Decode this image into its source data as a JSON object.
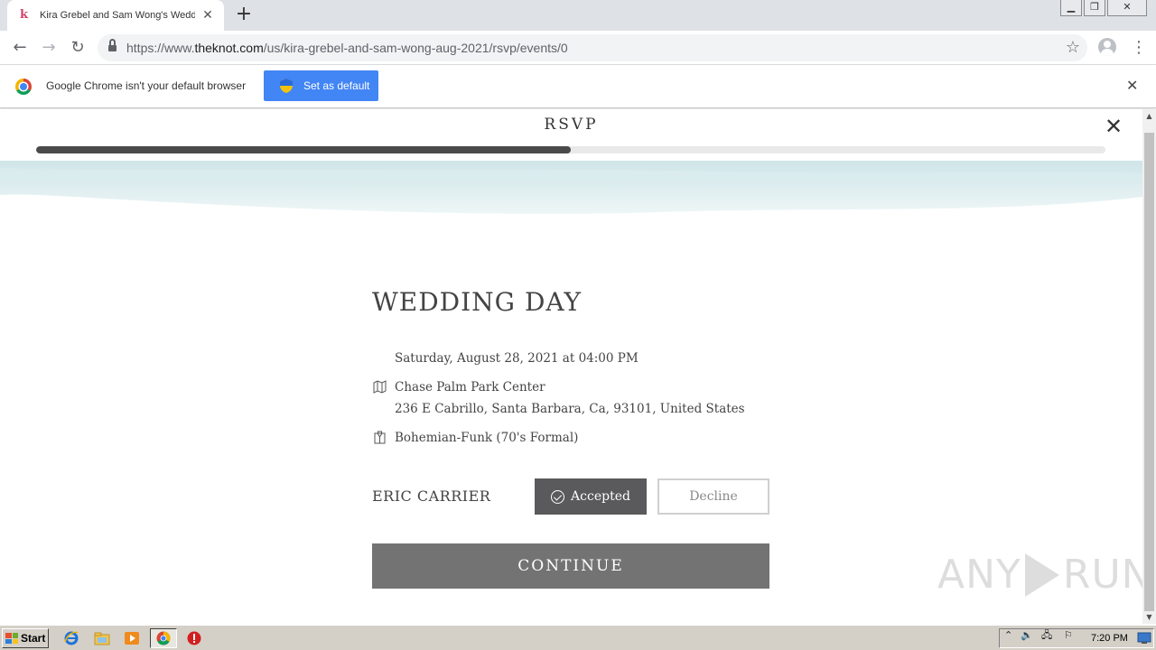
{
  "browser": {
    "tab_title": "Kira Grebel and Sam Wong's Wedding",
    "tab_favicon": "k",
    "url_scheme": "https://www.",
    "url_host": "theknot.com",
    "url_path": "/us/kira-grebel-and-sam-wong-aug-2021/rsvp/events/0",
    "infobar_message": "Google Chrome isn't your default browser",
    "set_default_label": "Set as default",
    "accent_color": "#4285f4"
  },
  "rsvp": {
    "title": "RSVP",
    "progress": 0.5,
    "event": {
      "name": "WEDDING DAY",
      "datetime": "Saturday, August 28, 2021 at 04:00 PM",
      "venue": "Chase Palm Park Center",
      "address": "236 E Cabrillo, Santa Barbara, Ca, 93101, United States",
      "attire": "Bohemian-Funk (70's Formal)"
    },
    "guest": {
      "name": "ERIC CARRIER",
      "accept_label": "Accepted",
      "decline_label": "Decline",
      "status": "accepted"
    },
    "continue_label": "CONTINUE"
  },
  "watermark": {
    "left": "ANY",
    "right": "RUN"
  },
  "taskbar": {
    "start_label": "Start",
    "clock": "7:20 PM"
  },
  "icons": {
    "venue": "map-icon",
    "attire": "attire-icon",
    "accept": "check-circle-icon"
  }
}
